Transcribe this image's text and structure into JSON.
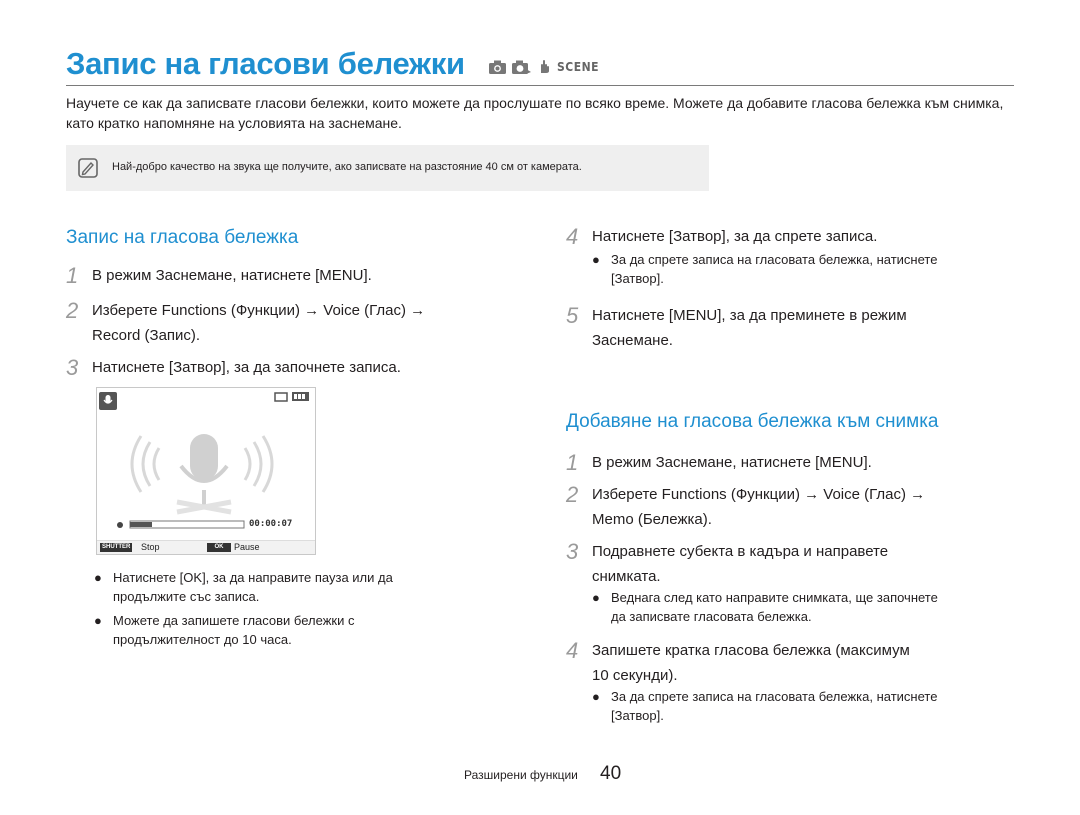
{
  "page": {
    "title": "Запис на гласови бележки",
    "mode_icons": [
      "camera-icon",
      "smart-camera-icon",
      "dual-is-icon",
      "scene-icon"
    ],
    "scene_label": "SCENE",
    "intro": "Научете се как да записвате гласови бележки, които можете да прослушате по всяко време. Можете да добавите гласова бележка към снимка, като кратко напомняне на условията на заснемане.",
    "note": "Най-добро качество на звука ще получите, ако записвате на разстояние 40 см от камерата."
  },
  "left": {
    "heading": "Запис на гласова бележка",
    "steps": [
      {
        "num": "1",
        "text": "В режим Заснемане, натиснете [MENU]."
      },
      {
        "num": "2",
        "text1": "Изберете Functions (Функции) → Voice (Глас) →",
        "text2": "Record (Запис)."
      },
      {
        "num": "3",
        "text": "Натиснете [Затвор], за да започнете записа."
      }
    ],
    "camera_screen": {
      "time": "00:00:07",
      "shutter_key": "SHUTTER",
      "shutter_label": "Stop",
      "ok_key": "OK",
      "ok_label": "Pause"
    },
    "bullets": [
      {
        "line1": "Натиснете [OK], за да направите пауза или да",
        "line2": "продължите със записа."
      },
      {
        "line1": "Можете да запишете гласови бележки с",
        "line2": "продължителност до 10 часа."
      }
    ]
  },
  "right": {
    "step4": {
      "num": "4",
      "text": "Натиснете [Затвор], за да спрете записа."
    },
    "step4_bullet": {
      "line1": "За да спрете записа на гласовата бележка, натиснете",
      "line2": "[Затвор]."
    },
    "step5": {
      "num": "5",
      "text1": "Натиснете [MENU], за да преминете в режим",
      "text2": "Заснемане."
    },
    "heading": "Добавяне на гласова бележка към снимка",
    "steps": [
      {
        "num": "1",
        "text": "В режим Заснемане, натиснете [MENU]."
      },
      {
        "num": "2",
        "text1": "Изберете Functions (Функции) → Voice (Глас) →",
        "text2": "Memo (Бележка)."
      },
      {
        "num": "3",
        "text1": "Подравнете субекта в кадъра и направете",
        "text2": "снимката."
      },
      {
        "num": "4",
        "text1": "Запишете кратка гласова бележка (максимум",
        "text2": "10 секунди)."
      }
    ],
    "step3_bullet": {
      "line1": "Веднага след като направите снимката, ще започнете",
      "line2": "да записвате гласовата бележка."
    }
  },
  "footer": {
    "section": "Разширени функции",
    "page": "40"
  },
  "colors": {
    "accent": "#1f8fd0",
    "step_number": "#9a9a9a",
    "note_bg": "#efefef"
  }
}
